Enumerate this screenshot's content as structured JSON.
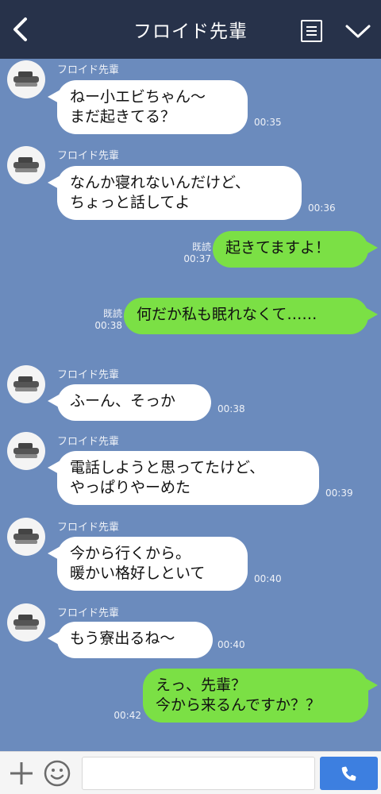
{
  "header": {
    "title": "フロイド先輩"
  },
  "messages": [
    {
      "type": "in",
      "sender": "フロイド先輩",
      "text": "ねー小エビちゃん〜\nまだ起きてる？",
      "time": "00:35"
    },
    {
      "type": "in",
      "sender": "フロイド先輩",
      "text": "なんか寝れないんだけど、\nちょっと話してよ",
      "time": "00:36"
    },
    {
      "type": "out",
      "read": "既読",
      "text": "起きてますよ！",
      "time": "00:37"
    },
    {
      "type": "out",
      "read": "既読",
      "text": "何だか私も眠れなくて……",
      "time": "00:38"
    },
    {
      "type": "in",
      "sender": "フロイド先輩",
      "text": "ふーん、そっか",
      "time": "00:38"
    },
    {
      "type": "in",
      "sender": "フロイド先輩",
      "text": "電話しようと思ってたけど、\nやっぱりやーめた",
      "time": "00:39"
    },
    {
      "type": "in",
      "sender": "フロイド先輩",
      "text": "今から行くから。\n暖かい格好しといて",
      "time": "00:40"
    },
    {
      "type": "in",
      "sender": "フロイド先輩",
      "text": "もう寮出るね〜",
      "time": "00:40"
    },
    {
      "type": "out",
      "read": "",
      "text": "えっ、先輩？\n今から来るんですか？？",
      "time": "00:42"
    }
  ],
  "icons": {
    "back": "chevron-left-icon",
    "menu": "list-icon",
    "collapse": "chevron-down-icon",
    "plus": "plus-icon",
    "emoji": "smiley-icon",
    "call": "phone-icon"
  },
  "colors": {
    "header_bg": "#27324a",
    "chat_bg": "#6b8bbd",
    "outgoing_bubble": "#7be045",
    "incoming_bubble": "#ffffff",
    "call_button": "#3d7fe0"
  }
}
